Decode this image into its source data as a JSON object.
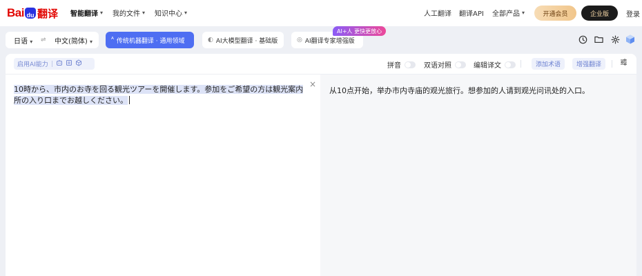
{
  "brand": {
    "bai": "Bai",
    "du": "du",
    "fanyi": "翻译"
  },
  "nav": {
    "left": [
      {
        "label": "智能翻译",
        "caret": "▾"
      },
      {
        "label": "我的文件",
        "caret": "▾"
      },
      {
        "label": "知识中心",
        "caret": "▾"
      }
    ],
    "right": [
      {
        "label": "人工翻译"
      },
      {
        "label": "翻译API"
      },
      {
        "label": "全部产品",
        "caret": "▾"
      }
    ],
    "vip_label": "开通会员",
    "enterprise_label": "企业版",
    "login_label": "登录"
  },
  "lang": {
    "source": "日语",
    "source_caret": "▾",
    "swap": "⇌",
    "target": "中文(简体)",
    "target_caret": "▾"
  },
  "modes": {
    "active": {
      "icon": "ᴬ",
      "label": "传统机器翻译 · 通用领域"
    },
    "m2": {
      "icon": "◐",
      "label": "AI大模型翻译 · 基础版"
    },
    "m3": {
      "icon": "◎",
      "label": "AI翻译专家增强版"
    },
    "badge": "AI+人 更快更放心"
  },
  "header_icons": [
    "clock-icon",
    "folder-icon",
    "gear-icon",
    "cube-icon"
  ],
  "toolbar": {
    "ai_power_label": "启用AI能力",
    "ai_sep": "|",
    "pinyin": "拼音",
    "bilingual": "双语对照",
    "edit_translation": "编辑译文",
    "add_term": "添加术语",
    "enhance": "增强翻译",
    "menu": "☰"
  },
  "source_text": {
    "line": "10時から、市内のお寺を回る観光ツアーを開催します。参加をご希望の方は観光案内所の入り口までお越しください。",
    "clear": "×"
  },
  "target_text": "从10点开始，举办市内寺庙的观光旅行。想参加的人请到观光问讯处的入口。"
}
